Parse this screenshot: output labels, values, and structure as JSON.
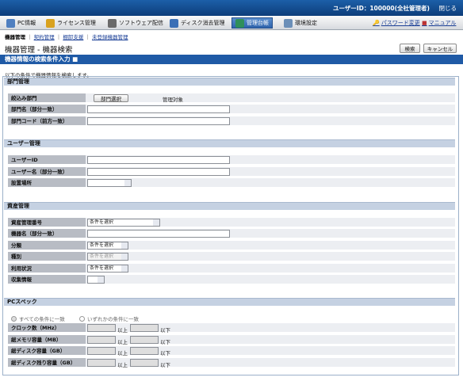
{
  "header": {
    "user": "ユーザーID：100000(全社管理者)",
    "close": "閉じる"
  },
  "menu": [
    {
      "label": "PC情報",
      "color": "#4f7fc0"
    },
    {
      "label": "ライセンス管理",
      "color": "#d9a21f"
    },
    {
      "label": "ソフトウェア配信",
      "color": "#6a6a6a"
    },
    {
      "label": "ディスク消去管理",
      "color": "#3a6fb6"
    },
    {
      "label": "管理台帳",
      "color": "#2f8f5a"
    },
    {
      "label": "環境設定",
      "color": "#6b8fb8"
    }
  ],
  "right_links": {
    "password": "パスワード変更",
    "manual": "マニュアル"
  },
  "subnav": {
    "current": "機器管理",
    "sep": "｜",
    "items": [
      "契約管理",
      "棚卸支援",
      "未登録機器管理"
    ]
  },
  "page_title": "機器管理 - 機器検索",
  "buttons": {
    "search": "検索",
    "cancel": "キャンセル"
  },
  "search_header": "機器情報の検索条件入力",
  "description": "以下の条件で機器情報を検索します。",
  "dept": {
    "title": "部門管理",
    "narrow": "絞込み部門",
    "select_btn": "部門選択",
    "target": "管理対象",
    "name": "部門名（部分一致）",
    "code": "部門コード（前方一致）"
  },
  "user": {
    "title": "ユーザー管理",
    "id": "ユーザーID",
    "name": "ユーザー名（部分一致）",
    "location": "設置場所"
  },
  "asset": {
    "title": "資産管理",
    "number": "資産管理番号",
    "number_sel": "条件を選択",
    "device": "機器名（部分一致）",
    "category": "分類",
    "category_sel": "条件を選択",
    "kind": "種別",
    "kind_sel": "条件を選択",
    "usage": "利用状況",
    "usage_sel": "条件を選択",
    "collect": "収集情報"
  },
  "pc": {
    "title": "PCスペック",
    "radio_all": "すべての条件に一致",
    "radio_any": "いずれかの条件に一致",
    "rows": [
      {
        "label": "クロック数（MHz）"
      },
      {
        "label": "総メモリ容量（MB）"
      },
      {
        "label": "総ディスク容量（GB）"
      },
      {
        "label": "総ディスク残り容量（GB）"
      }
    ],
    "min": "以上",
    "max": "以下"
  }
}
